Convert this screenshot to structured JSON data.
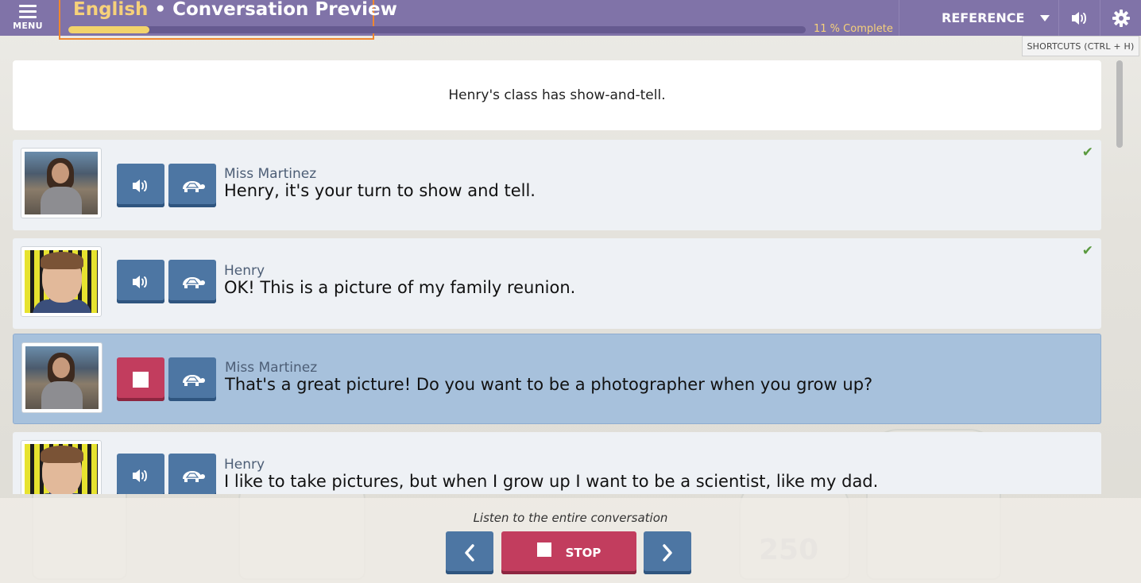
{
  "colors": {
    "topbar": "#8073a8",
    "accent_yellow": "#f6d17a",
    "button_blue": "#4d76a3",
    "stop_red": "#c23d5e",
    "active_row": "#a7c1dc",
    "check_green": "#5a9a3f"
  },
  "header": {
    "menu_label": "MENU",
    "menu_icon": "hamburger-icon",
    "title_language": "English",
    "title_separator": "•",
    "title_text": "Conversation Preview",
    "progress_percent": 11,
    "progress_label": "11 % Complete",
    "reference_label": "REFERENCE",
    "reference_icon": "caret-down-icon",
    "audio_icon": "speaker-icon",
    "settings_icon": "gear-icon",
    "shortcuts_tooltip": "SHORTCUTS (CTRL + H)"
  },
  "scene": {
    "description": "Henry's class has show-and-tell."
  },
  "conversation": [
    {
      "speaker": "Miss Martinez",
      "text": "Henry, it's your turn to show and tell.",
      "avatar": "teacher",
      "completed": true,
      "playing": false,
      "play_icon": "speaker-icon",
      "slow_icon": "turtle-icon"
    },
    {
      "speaker": "Henry",
      "text": "OK! This is a picture of my family reunion.",
      "avatar": "boy",
      "completed": true,
      "playing": false,
      "play_icon": "speaker-icon",
      "slow_icon": "turtle-icon"
    },
    {
      "speaker": "Miss Martinez",
      "text": "That's a great picture! Do you want to be a photographer when you grow up?",
      "avatar": "teacher",
      "completed": false,
      "playing": true,
      "play_icon": "stop-icon",
      "slow_icon": "turtle-icon"
    },
    {
      "speaker": "Henry",
      "text": "I like to take pictures, but when I grow up I want to be a scientist, like my dad.",
      "avatar": "boy",
      "completed": false,
      "playing": false,
      "play_icon": "speaker-icon",
      "slow_icon": "turtle-icon"
    }
  ],
  "footer": {
    "instruction": "Listen to the entire conversation",
    "prev_icon": "chevron-left-icon",
    "next_icon": "chevron-right-icon",
    "stop_label": "STOP",
    "stop_icon": "stop-icon"
  }
}
